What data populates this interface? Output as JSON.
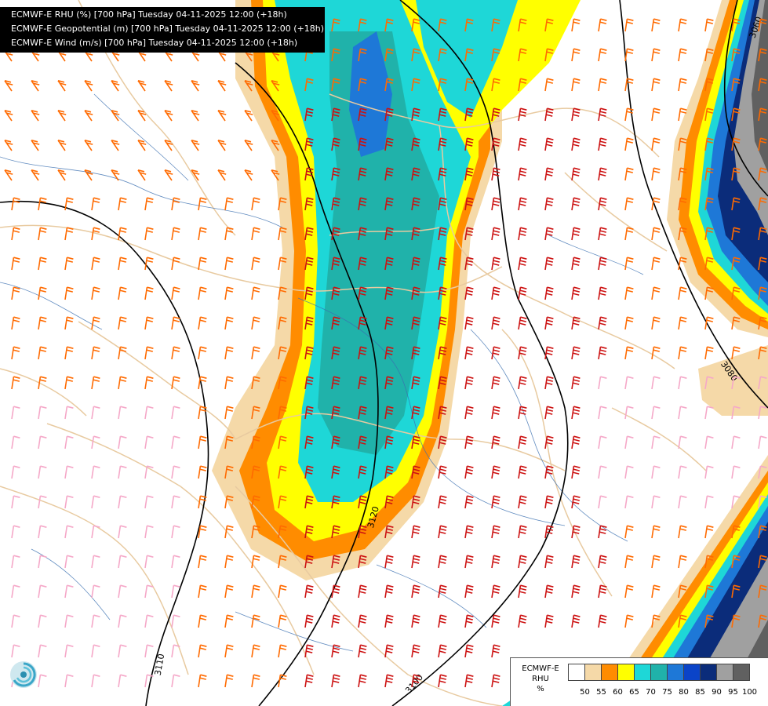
{
  "header": {
    "line1": "ECMWF-E RHU (%) [700 hPa] Tuesday 04-11-2025 12:00 (+18h)",
    "line2": "ECMWF-E Geopotential (m) [700 hPa] Tuesday 04-11-2025 12:00 (+18h)",
    "line3": "ECMWF-E Wind (m/s) [700 hPa] Tuesday 04-11-2025 12:00 (+18h)"
  },
  "legend": {
    "title_line1": "ECMWF-E",
    "title_line2": "RHU",
    "unit": "%",
    "ticks": [
      "50",
      "55",
      "60",
      "65",
      "70",
      "75",
      "80",
      "85",
      "90",
      "95",
      "100"
    ],
    "colors": [
      "#ffffff",
      "#f5d9a8",
      "#ff8c00",
      "#ffff00",
      "#1ed7d7",
      "#20b2aa",
      "#1e78d7",
      "#0b44c8",
      "#0b2c7a",
      "#a0a0a0",
      "#606060"
    ]
  },
  "contours": {
    "labels": [
      "3060",
      "3080",
      "3120",
      "3110",
      "3100"
    ]
  },
  "colors": {
    "border_country": "#e8caa0",
    "river": "#3a6fb0",
    "isoline": "#000000",
    "wind_strong": "#cc1111",
    "wind_medium": "#ff6a00",
    "wind_weak": "#f5a8c8"
  },
  "icons": {
    "logo": "ecmwf-logo-icon"
  }
}
